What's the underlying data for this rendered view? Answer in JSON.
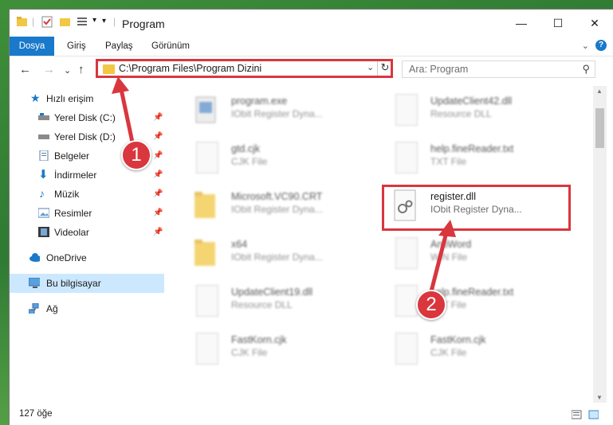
{
  "window": {
    "title": "Program"
  },
  "titlebar": {
    "minimize": "—",
    "maximize": "☐",
    "close": "✕"
  },
  "ribbon": {
    "tabs": [
      "Dosya",
      "Giriş",
      "Paylaş",
      "Görünüm"
    ],
    "help": "?",
    "expand": "⌄"
  },
  "nav": {
    "back": "←",
    "forward": "→",
    "recent": "⌄",
    "up": "↑"
  },
  "address": {
    "path": "C:\\Program Files\\Program Dizini",
    "dropdown": "⌄",
    "refresh": "↻"
  },
  "search": {
    "placeholder": "Ara: Program",
    "icon": "⚲"
  },
  "sidebar": {
    "quick_access": "Hızlı erişim",
    "items": [
      "Yerel Disk (C:)",
      "Yerel Disk (D:)",
      "Belgeler",
      "İndirmeler",
      "Müzik",
      "Resimler",
      "Videolar"
    ],
    "onedrive": "OneDrive",
    "this_pc": "Bu bilgisayar",
    "network": "Ağ"
  },
  "files": [
    {
      "name": "program.exe",
      "type": "IObit Register Dyna..."
    },
    {
      "name": "UpdateClient42.dll",
      "type": "Resource DLL"
    },
    {
      "name": "gtd.cjk",
      "type": "CJK File"
    },
    {
      "name": "help.fineReader.txt",
      "type": "TXT File"
    },
    {
      "name": "Microsoft.VC90.CRT",
      "type": "IObit Register Dyna..."
    },
    {
      "name": "register.dll",
      "type": "IObit Register Dyna..."
    },
    {
      "name": "x64",
      "type": "IObit Register Dyna..."
    },
    {
      "name": "AntiWord",
      "type": "WIN File"
    },
    {
      "name": "UpdateClient19.dll",
      "type": "Resource DLL"
    },
    {
      "name": "help.fineReader.txt",
      "type": "TXT File"
    },
    {
      "name": "FastKorn.cjk",
      "type": "CJK File"
    },
    {
      "name": "FastKorn.cjk",
      "type": "CJK File"
    }
  ],
  "status": {
    "count": "127 öğe"
  },
  "annotations": {
    "step1": "1",
    "step2": "2"
  },
  "colors": {
    "accent": "#1979ca",
    "highlight": "#d9363e",
    "folder": "#f1c744"
  }
}
